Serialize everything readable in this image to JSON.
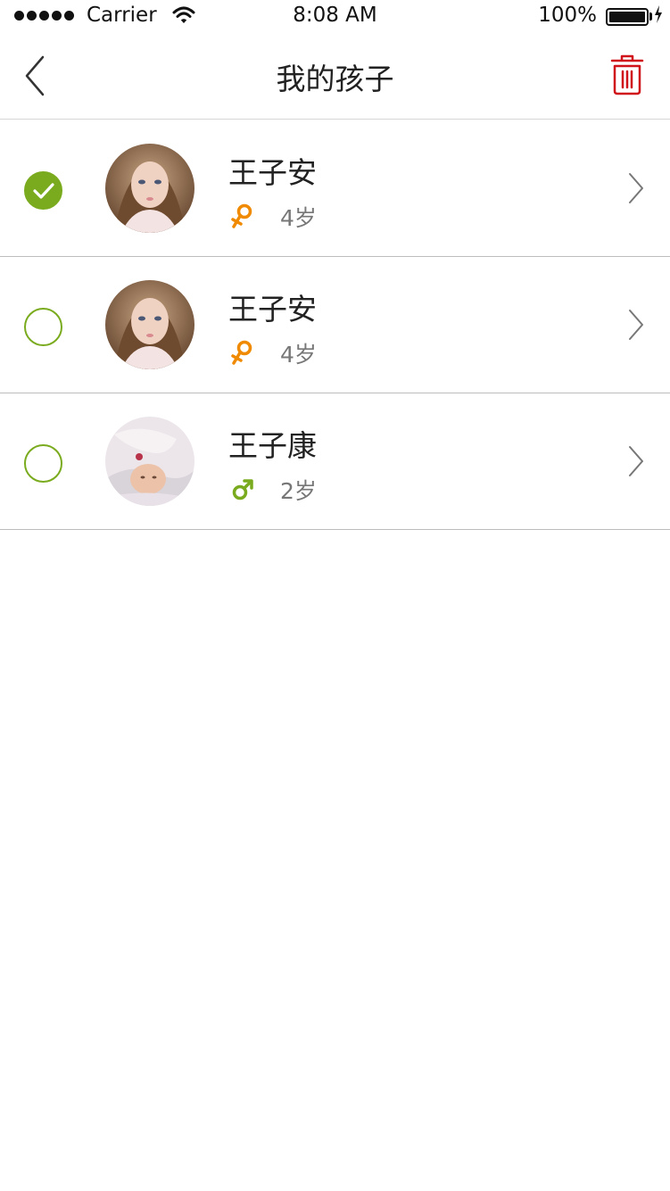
{
  "status_bar": {
    "carrier": "Carrier",
    "time": "8:08 AM",
    "battery": "100%",
    "battery_level": 1.0
  },
  "nav": {
    "title": "我的孩子",
    "back_icon": "chevron-left-icon",
    "delete_icon": "trash-icon",
    "delete_color": "#d0121b"
  },
  "children": [
    {
      "name": "王子安",
      "age": "4岁",
      "gender": "female",
      "gender_icon": "female-icon",
      "gender_color": "#f08a00",
      "selected": true
    },
    {
      "name": "王子安",
      "age": "4岁",
      "gender": "female",
      "gender_icon": "female-icon",
      "gender_color": "#f08a00",
      "selected": false
    },
    {
      "name": "王子康",
      "age": "2岁",
      "gender": "male",
      "gender_icon": "male-icon",
      "gender_color": "#7aab1e",
      "selected": false
    }
  ],
  "colors": {
    "accent": "#7aab1e",
    "female": "#f08a00",
    "male": "#7aab1e",
    "delete": "#d0121b"
  }
}
